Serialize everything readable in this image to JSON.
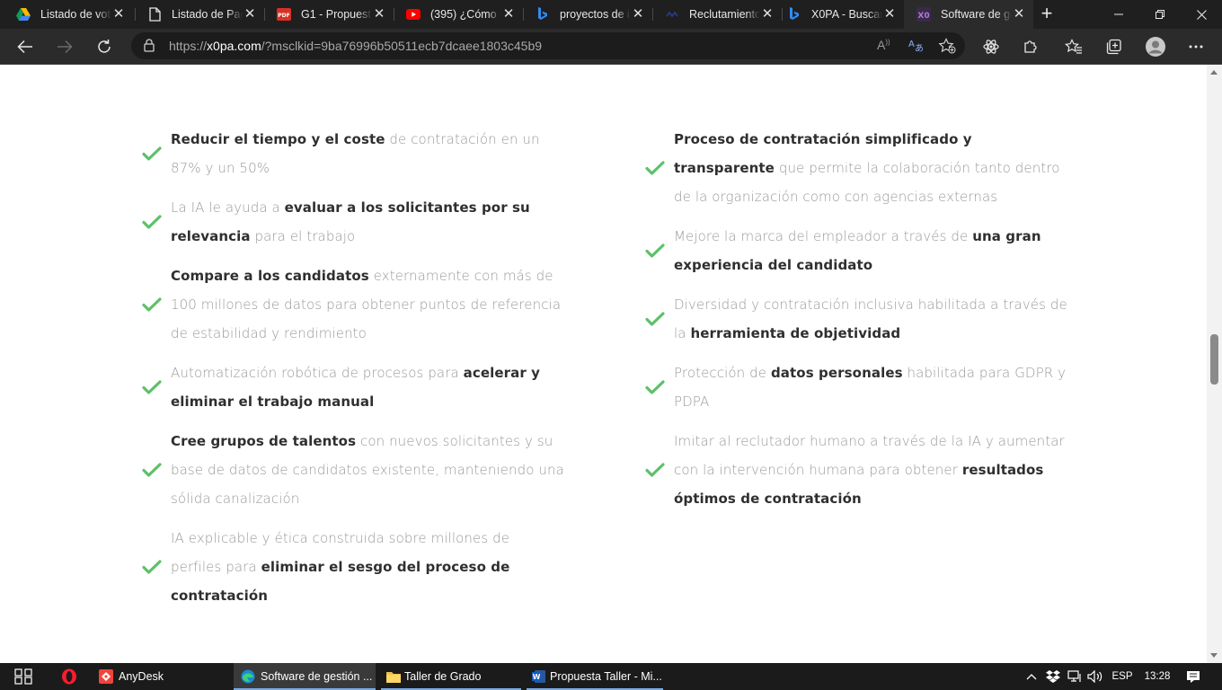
{
  "browser": {
    "tabs": [
      {
        "title": "Listado de vot",
        "icon": "drive-icon"
      },
      {
        "title": "Listado de Pag",
        "icon": "document-icon"
      },
      {
        "title": "G1 - Propuesta",
        "icon": "pdf-icon"
      },
      {
        "title": "(395) ¿Cómo C",
        "icon": "youtube-icon"
      },
      {
        "title": "proyectos de i",
        "icon": "bing-icon"
      },
      {
        "title": "Reclutamiento",
        "icon": "site-icon"
      },
      {
        "title": "X0PA - Buscar",
        "icon": "bing-icon"
      },
      {
        "title": "Software de ge",
        "icon": "x0pa-icon"
      }
    ],
    "url_prefix": "https://",
    "url_host": "x0pa.com",
    "url_rest": "/?msclkid=9ba76996b50511ecb7dcaee1803c45b9"
  },
  "content": {
    "left": [
      {
        "segments": [
          {
            "t": "Reducir el tiempo y el coste",
            "b": true
          },
          {
            "t": " de contratación en un 87% y un 50%",
            "b": false
          }
        ]
      },
      {
        "segments": [
          {
            "t": "La IA le ayuda a ",
            "b": false
          },
          {
            "t": "evaluar a los solicitantes por su relevancia",
            "b": true
          },
          {
            "t": " para el trabajo",
            "b": false
          }
        ]
      },
      {
        "segments": [
          {
            "t": "Compare a los candidatos",
            "b": true
          },
          {
            "t": " externamente con más de 100 millones de datos para obtener puntos de referencia de estabilidad y rendimiento",
            "b": false
          }
        ]
      },
      {
        "segments": [
          {
            "t": "Automatización robótica de procesos para ",
            "b": false
          },
          {
            "t": "acelerar y eliminar el trabajo manual",
            "b": true
          }
        ]
      },
      {
        "segments": [
          {
            "t": "Cree grupos de talentos",
            "b": true
          },
          {
            "t": " con nuevos solicitantes y su base de datos de candidatos existente, manteniendo una sólida canalización",
            "b": false
          }
        ]
      },
      {
        "segments": [
          {
            "t": "IA explicable y ética construida sobre millones de perfiles para ",
            "b": false
          },
          {
            "t": "eliminar el sesgo del proceso de contratación",
            "b": true
          }
        ]
      }
    ],
    "right": [
      {
        "segments": [
          {
            "t": "Proceso de contratación simplificado y transparente",
            "b": true
          },
          {
            "t": " que permite la colaboración tanto dentro de la organización como con agencias externas",
            "b": false
          }
        ]
      },
      {
        "segments": [
          {
            "t": "Mejore la marca del empleador a través de ",
            "b": false
          },
          {
            "t": "una gran experiencia del candidato",
            "b": true
          }
        ]
      },
      {
        "segments": [
          {
            "t": "Diversidad y contratación inclusiva habilitada a través de la ",
            "b": false
          },
          {
            "t": "herramienta de objetividad",
            "b": true
          }
        ]
      },
      {
        "segments": [
          {
            "t": "Protección de ",
            "b": false
          },
          {
            "t": "datos personales",
            "b": true
          },
          {
            "t": " habilitada para GDPR y PDPA",
            "b": false
          }
        ]
      },
      {
        "segments": [
          {
            "t": "Imitar al reclutador humano a través de la IA y aumentar con la intervención humana para obtener ",
            "b": false
          },
          {
            "t": "resultados óptimos de contratación",
            "b": true
          }
        ]
      }
    ],
    "check_color": "#5cc16a"
  },
  "taskbar": {
    "apps": [
      {
        "label": "AnyDesk",
        "icon": "anydesk-icon"
      },
      {
        "label": "Software de gestión ...",
        "icon": "edge-icon"
      },
      {
        "label": "Taller de Grado",
        "icon": "folder-icon"
      },
      {
        "label": "Propuesta Taller - Mi...",
        "icon": "word-icon"
      }
    ],
    "language": "ESP",
    "time": "13:28"
  }
}
